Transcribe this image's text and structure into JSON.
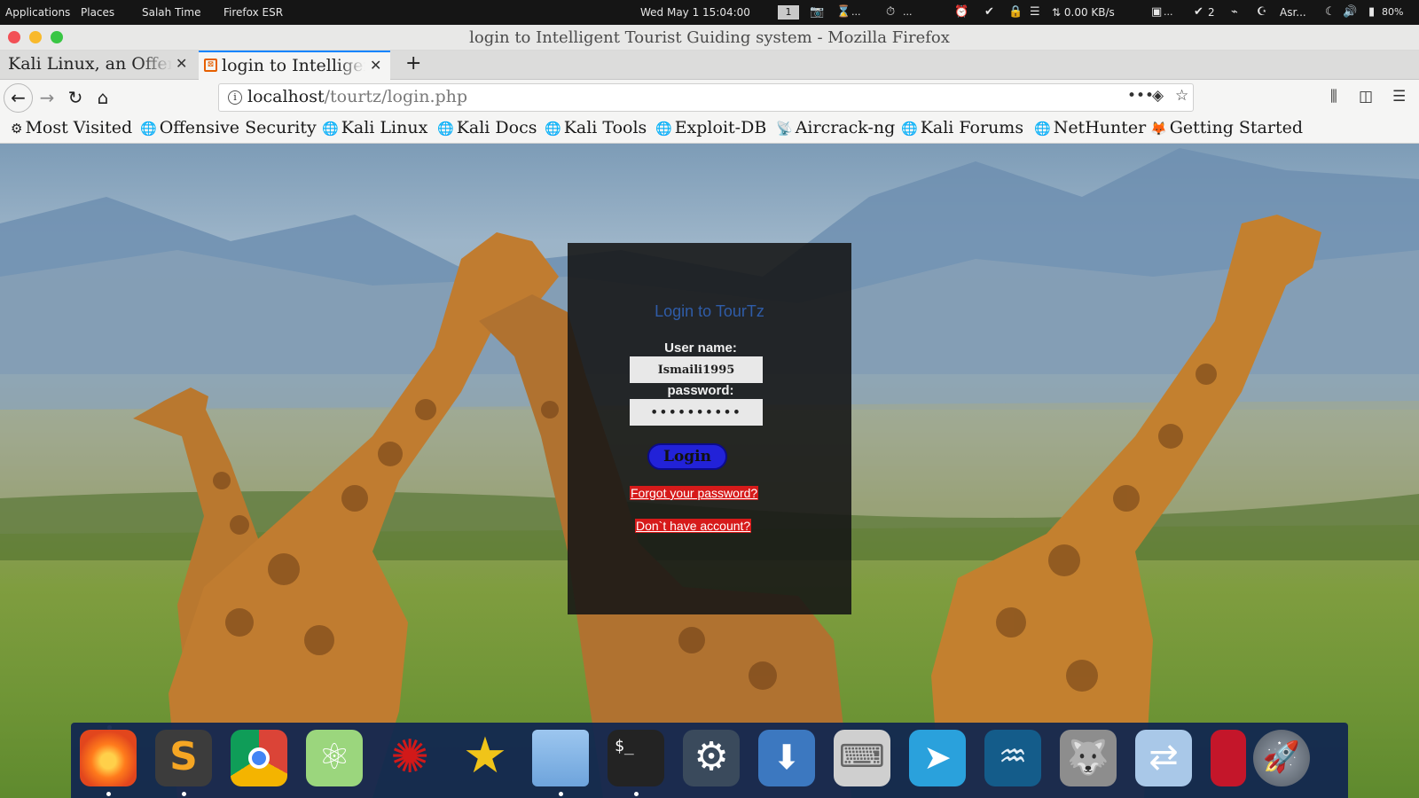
{
  "system_panel": {
    "applications": "Applications",
    "places": "Places",
    "salah_time": "Salah Time",
    "firefox_esr": "Firefox ESR",
    "datetime": "Wed May 1  15:04:00",
    "workspace": "1",
    "ellipsis_1": "...",
    "ellipsis_2": "...",
    "net_speed": "⇅ 0.00 KB/s",
    "ellipsis_3": "...",
    "updates_count": "2",
    "prayer": "Asr...",
    "battery": "80%"
  },
  "window": {
    "title": "login to Intelligent Tourist Guiding system - Mozilla Firefox"
  },
  "tabs": [
    {
      "label": "Kali Linux, an Offensive Security"
    },
    {
      "label": "login to Intelligent Tourist Guiding system"
    }
  ],
  "url": {
    "host": "localhost",
    "path": "/tourtz/login.php"
  },
  "bookmarks": [
    {
      "label": "Most Visited",
      "icon": "gear-icon"
    },
    {
      "label": "Offensive Security",
      "icon": "globe-icon"
    },
    {
      "label": "Kali Linux",
      "icon": "globe-icon"
    },
    {
      "label": "Kali Docs",
      "icon": "globe-icon"
    },
    {
      "label": "Kali Tools",
      "icon": "globe-icon"
    },
    {
      "label": "Exploit-DB",
      "icon": "globe-icon"
    },
    {
      "label": "Aircrack-ng",
      "icon": "aircrack-icon"
    },
    {
      "label": "Kali Forums",
      "icon": "globe-icon"
    },
    {
      "label": "NetHunter",
      "icon": "globe-icon"
    },
    {
      "label": "Getting Started",
      "icon": "firefox-icon"
    }
  ],
  "login": {
    "title": "Login to TourTz",
    "username_label": "User name:",
    "username_value": "Ismaili1995",
    "password_label": "password:",
    "password_value": "••••••••••",
    "button": "Login",
    "forgot": "Forgot your password?",
    "register": "Don`t have account?"
  },
  "colors": {
    "login_title": "#2f5ca8",
    "login_button": "#2222d8",
    "link_background": "#d61a1a",
    "dock_background": "#112650"
  },
  "dock": {
    "apps": [
      "firefox-icon",
      "sublime-text-icon",
      "chrome-icon",
      "atom-icon",
      "maltego-icon",
      "kstars-icon",
      "files-icon",
      "terminal-icon",
      "settings-icon",
      "software-installer-icon",
      "keyboard-settings-icon",
      "telegram-icon",
      "mysql-workbench-icon",
      "gimp-icon",
      "file-transfer-icon",
      "app-icon-red",
      "launchpad-icon"
    ]
  }
}
